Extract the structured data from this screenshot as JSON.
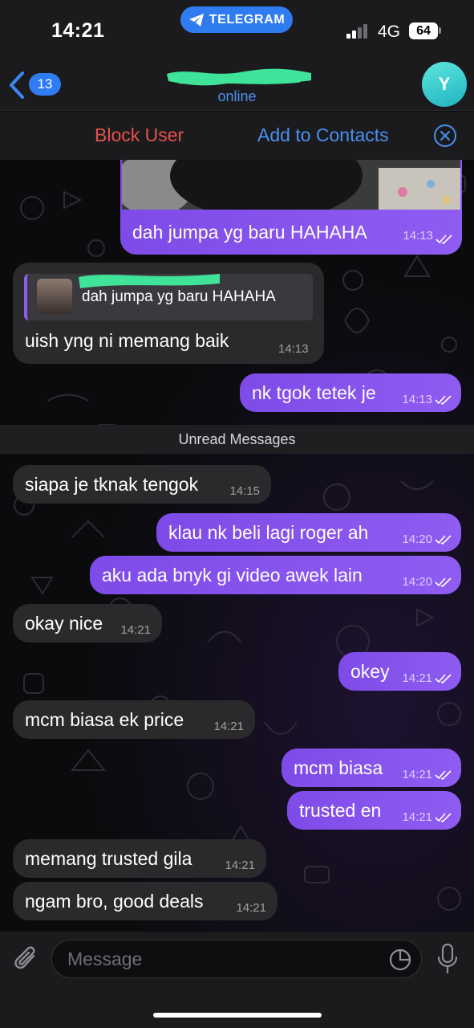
{
  "status_bar": {
    "time": "14:21",
    "app_pill": "TELEGRAM",
    "network": "4G",
    "battery": "64"
  },
  "header": {
    "back_count": "13",
    "status": "online",
    "avatar_initial": "Y"
  },
  "actions": {
    "block": "Block User",
    "add_contact": "Add to Contacts"
  },
  "messages": [
    {
      "text": "dah jumpa yg baru HAHAHA",
      "time": "14:13",
      "dir": "out"
    },
    {
      "quote": "dah jumpa yg baru HAHAHA",
      "text": "uish yng ni memang baik",
      "time": "14:13",
      "dir": "in"
    },
    {
      "text": "nk tgok tetek je",
      "time": "14:13",
      "dir": "out"
    },
    {
      "text": "siapa je tknak tengok",
      "time": "14:15",
      "dir": "in"
    },
    {
      "text": "klau nk beli lagi roger ah",
      "time": "14:20",
      "dir": "out"
    },
    {
      "text": "aku ada bnyk gi video awek lain",
      "time": "14:20",
      "dir": "out"
    },
    {
      "text": "okay nice",
      "time": "14:21",
      "dir": "in"
    },
    {
      "text": "okey",
      "time": "14:21",
      "dir": "out"
    },
    {
      "text": "mcm biasa ek price",
      "time": "14:21",
      "dir": "in"
    },
    {
      "text": "mcm biasa",
      "time": "14:21",
      "dir": "out"
    },
    {
      "text": "trusted en",
      "time": "14:21",
      "dir": "out"
    },
    {
      "text": "memang trusted gila",
      "time": "14:21",
      "dir": "in"
    },
    {
      "text": "ngam bro, good deals",
      "time": "14:21",
      "dir": "in"
    }
  ],
  "unread_label": "Unread Messages",
  "composer": {
    "placeholder": "Message"
  },
  "colors": {
    "accent": "#4a8ff0",
    "outgoing": "#8a55f0",
    "incoming": "#2a2a2d",
    "danger": "#e5534b"
  }
}
